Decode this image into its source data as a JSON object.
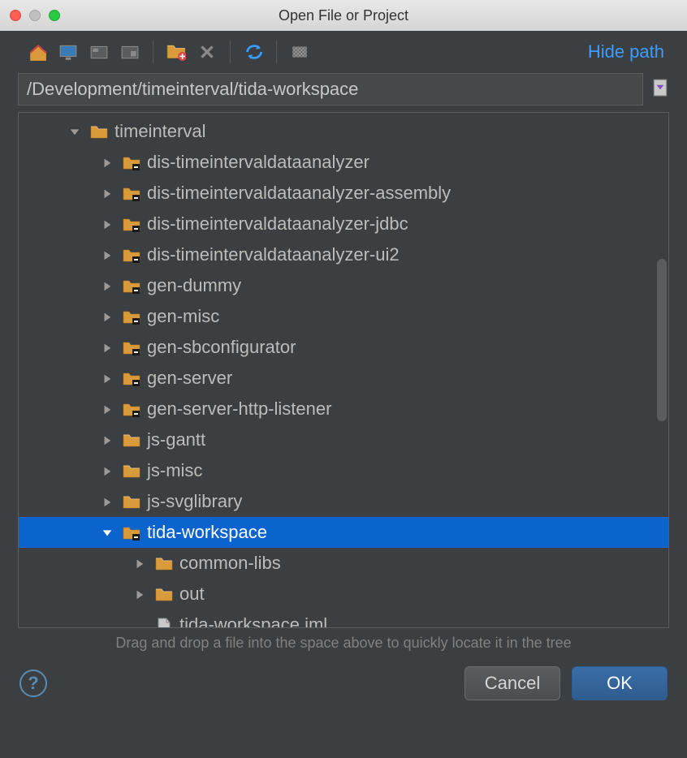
{
  "title": "Open File or Project",
  "hide_path": "Hide path",
  "path": "/Development/timeinterval/tida-workspace",
  "hint": "Drag and drop a file into the space above to quickly locate it in the tree",
  "buttons": {
    "cancel": "Cancel",
    "ok": "OK",
    "help": "?"
  },
  "toolbar": {
    "home": "home-icon",
    "desktop": "desktop-icon",
    "project": "project-icon",
    "module": "module-icon",
    "newfolder": "new-folder-icon",
    "delete": "delete-icon",
    "refresh": "refresh-icon",
    "showhidden": "show-hidden-icon"
  },
  "tree": [
    {
      "indent": 1,
      "expanded": true,
      "icon": "folder",
      "label": "timeinterval"
    },
    {
      "indent": 2,
      "expanded": false,
      "icon": "folder-dot",
      "label": "dis-timeintervaldataanalyzer"
    },
    {
      "indent": 2,
      "expanded": false,
      "icon": "folder-dot",
      "label": "dis-timeintervaldataanalyzer-assembly"
    },
    {
      "indent": 2,
      "expanded": false,
      "icon": "folder-dot",
      "label": "dis-timeintervaldataanalyzer-jdbc"
    },
    {
      "indent": 2,
      "expanded": false,
      "icon": "folder-dot",
      "label": "dis-timeintervaldataanalyzer-ui2"
    },
    {
      "indent": 2,
      "expanded": false,
      "icon": "folder-dot",
      "label": "gen-dummy"
    },
    {
      "indent": 2,
      "expanded": false,
      "icon": "folder-dot",
      "label": "gen-misc"
    },
    {
      "indent": 2,
      "expanded": false,
      "icon": "folder-dot",
      "label": "gen-sbconfigurator"
    },
    {
      "indent": 2,
      "expanded": false,
      "icon": "folder-dot",
      "label": "gen-server"
    },
    {
      "indent": 2,
      "expanded": false,
      "icon": "folder-dot",
      "label": "gen-server-http-listener"
    },
    {
      "indent": 2,
      "expanded": false,
      "icon": "folder",
      "label": "js-gantt"
    },
    {
      "indent": 2,
      "expanded": false,
      "icon": "folder",
      "label": "js-misc"
    },
    {
      "indent": 2,
      "expanded": false,
      "icon": "folder",
      "label": "js-svglibrary"
    },
    {
      "indent": 2,
      "expanded": true,
      "icon": "folder-dot",
      "label": "tida-workspace",
      "selected": true
    },
    {
      "indent": 3,
      "expanded": false,
      "icon": "folder",
      "label": "common-libs"
    },
    {
      "indent": 3,
      "expanded": false,
      "icon": "folder",
      "label": "out"
    },
    {
      "indent": 3,
      "expanded": null,
      "icon": "file",
      "label": "tida-workspace.iml"
    }
  ]
}
